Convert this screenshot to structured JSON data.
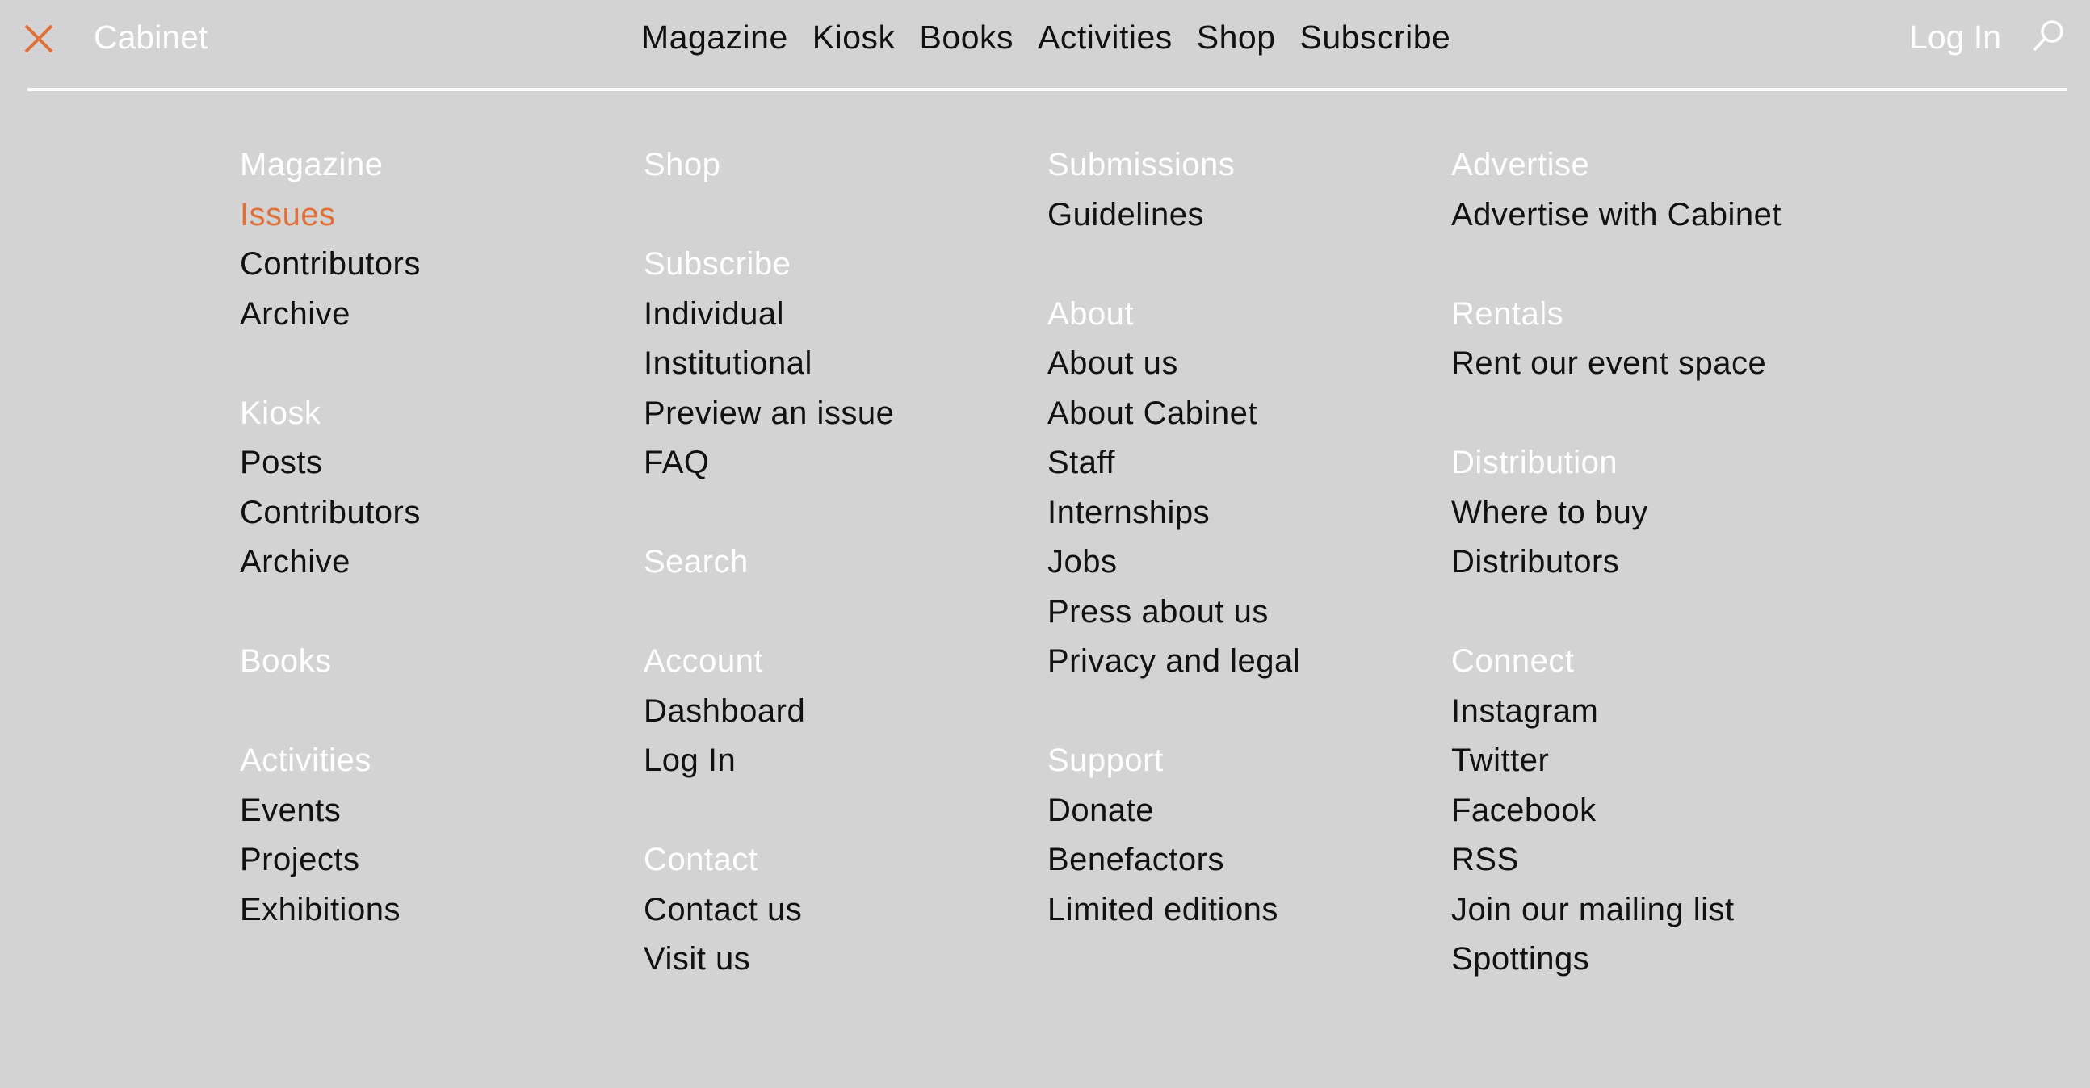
{
  "header": {
    "brand": "Cabinet",
    "nav": [
      "Magazine",
      "Kiosk",
      "Books",
      "Activities",
      "Shop",
      "Subscribe"
    ],
    "login": "Log In",
    "icons": {
      "close": "close-icon",
      "search": "search-icon"
    },
    "colors": {
      "background": "#d3d3d3",
      "accent": "#e0703a",
      "heading": "#ffffff",
      "link": "#111111"
    }
  },
  "menu": {
    "columns": [
      {
        "sections": [
          {
            "heading": "Magazine",
            "row": 0,
            "links": [
              "Issues",
              "Contributors",
              "Archive"
            ],
            "active": "Issues"
          },
          {
            "heading": "Kiosk",
            "row": 5,
            "links": [
              "Posts",
              "Contributors",
              "Archive"
            ]
          },
          {
            "heading": "Books",
            "row": 10,
            "links": []
          },
          {
            "heading": "Activities",
            "row": 12,
            "links": [
              "Events",
              "Projects",
              "Exhibitions"
            ]
          }
        ]
      },
      {
        "sections": [
          {
            "heading": "Shop",
            "row": 0,
            "links": []
          },
          {
            "heading": "Subscribe",
            "row": 2,
            "links": [
              "Individual",
              "Institutional",
              "Preview an issue",
              "FAQ"
            ]
          },
          {
            "heading": "Search",
            "row": 8,
            "links": []
          },
          {
            "heading": "Account",
            "row": 10,
            "links": [
              "Dashboard",
              "Log In"
            ]
          },
          {
            "heading": "Contact",
            "row": 14,
            "links": [
              "Contact us",
              "Visit us"
            ]
          }
        ]
      },
      {
        "sections": [
          {
            "heading": "Submissions",
            "row": 0,
            "links": [
              "Guidelines"
            ]
          },
          {
            "heading": "About",
            "row": 3,
            "links": [
              "About us",
              "About Cabinet",
              "Staff",
              "Internships",
              "Jobs",
              "Press about us",
              "Privacy and legal"
            ]
          },
          {
            "heading": "Support",
            "row": 12,
            "links": [
              "Donate",
              "Benefactors",
              "Limited editions"
            ]
          }
        ]
      },
      {
        "sections": [
          {
            "heading": "Advertise",
            "row": 0,
            "links": [
              "Advertise with Cabinet"
            ]
          },
          {
            "heading": "Rentals",
            "row": 3,
            "links": [
              "Rent our event space"
            ]
          },
          {
            "heading": "Distribution",
            "row": 6,
            "links": [
              "Where to buy",
              "Distributors"
            ]
          },
          {
            "heading": "Connect",
            "row": 10,
            "links": [
              "Instagram",
              "Twitter",
              "Facebook",
              "RSS",
              "Join our mailing list",
              "Spottings"
            ]
          }
        ]
      }
    ]
  }
}
